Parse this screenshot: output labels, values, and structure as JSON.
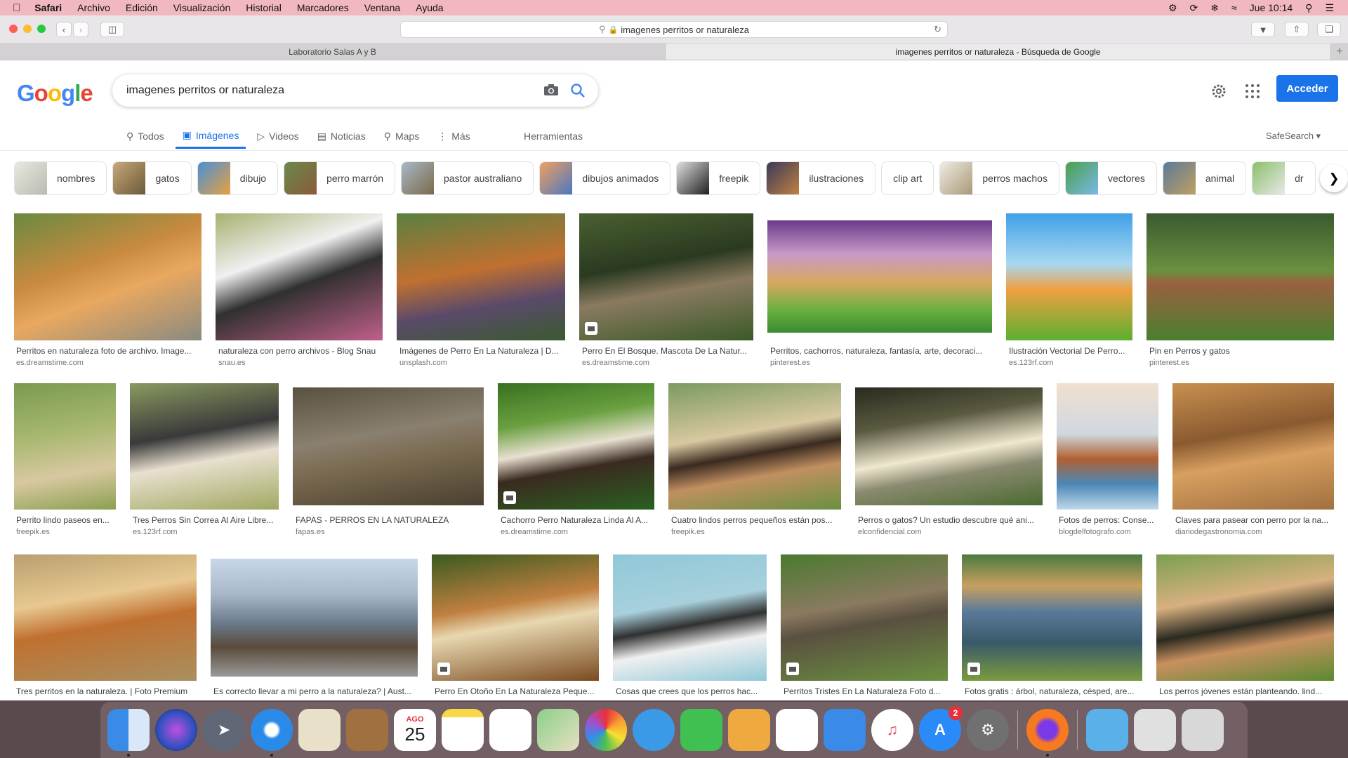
{
  "menubar": {
    "app": "Safari",
    "items": [
      "Archivo",
      "Edición",
      "Visualización",
      "Historial",
      "Marcadores",
      "Ventana",
      "Ayuda"
    ],
    "clock": "Jue 10:14"
  },
  "browser": {
    "url": "imagenes perritos or naturaleza",
    "tabs": [
      "Laboratorio Salas A y B",
      "imagenes perritos or naturaleza - Búsqueda de Google"
    ]
  },
  "google": {
    "logo": "Google",
    "query": "imagenes perritos or naturaleza",
    "signin": "Acceder",
    "safesearch": "SafeSearch ▾",
    "tools": "Herramientas",
    "nav": [
      "Todos",
      "Imágenes",
      "Videos",
      "Noticias",
      "Maps",
      "Más"
    ]
  },
  "chips": [
    "nombres",
    "gatos",
    "dibujo",
    "perro marrón",
    "pastor australiano",
    "dibujos animados",
    "freepik",
    "ilustraciones",
    "clip art",
    "perros machos",
    "vectores",
    "animal",
    "dr"
  ],
  "colors": {
    "accent": "#1a73e8",
    "menubar": "#f2b8c0"
  },
  "results": [
    {
      "caption": "Perritos en naturaleza foto de archivo. Image...",
      "source": "es.dreamstime.com"
    },
    {
      "caption": "naturaleza con perro archivos - Blog Snau",
      "source": "snau.es"
    },
    {
      "caption": "Imágenes de Perro En La Naturaleza | D...",
      "source": "unsplash.com"
    },
    {
      "caption": "Perro En El Bosque. Mascota De La Natur...",
      "source": "es.dreamstime.com"
    },
    {
      "caption": "Perritos, cachorros, naturaleza, fantasía, arte, decoraci...",
      "source": "pinterest.es"
    },
    {
      "caption": "Ilustración Vectorial De Perro...",
      "source": "es.123rf.com"
    },
    {
      "caption": "Pin en Perros y gatos",
      "source": "pinterest.es"
    },
    {
      "caption": "Perrito lindo paseos en...",
      "source": "freepik.es"
    },
    {
      "caption": "Tres Perros Sin Correa Al Aire Libre...",
      "source": "es.123rf.com"
    },
    {
      "caption": "FAPAS - PERROS EN LA NATURALEZA",
      "source": "fapas.es"
    },
    {
      "caption": "Cachorro Perro Naturaleza Linda Al A...",
      "source": "es.dreamstime.com"
    },
    {
      "caption": "Cuatro lindos perros pequeños están pos...",
      "source": "freepik.es"
    },
    {
      "caption": "Perros o gatos? Un estudio descubre qué ani...",
      "source": "elconfidencial.com"
    },
    {
      "caption": "Fotos de perros: Conse...",
      "source": "blogdelfotografo.com"
    },
    {
      "caption": "Claves para pasear con perro por la na...",
      "source": "diariodegastronomia.com"
    },
    {
      "caption": "Tres perritos en la naturaleza. | Foto Premium",
      "source": ""
    },
    {
      "caption": "Es correcto llevar a mi perro a la naturaleza? | Aust...",
      "source": ""
    },
    {
      "caption": "Perro En Otoño En La Naturaleza Peque...",
      "source": ""
    },
    {
      "caption": "Cosas que crees que los perros hac...",
      "source": ""
    },
    {
      "caption": "Perritos Tristes En La Naturaleza Foto d...",
      "source": ""
    },
    {
      "caption": "Fotos gratis : árbol, naturaleza, césped, are...",
      "source": ""
    },
    {
      "caption": "Los perros jóvenes están planteando. lind...",
      "source": ""
    }
  ],
  "dock": {
    "calendar_month": "AGO",
    "calendar_day": "25",
    "appstore_badge": "2"
  }
}
